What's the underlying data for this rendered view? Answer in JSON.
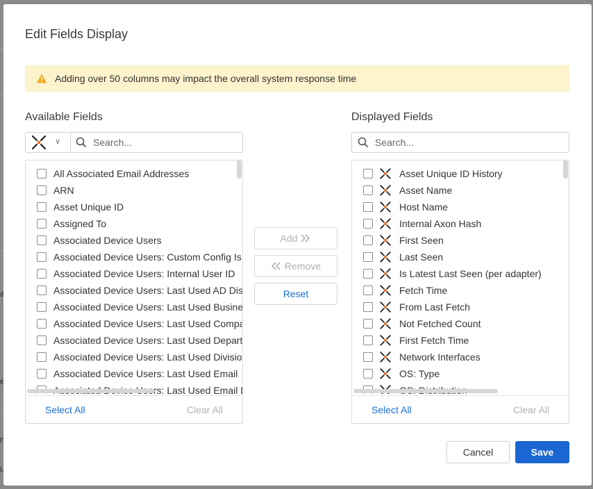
{
  "background": {
    "edge_chars": [
      "a",
      "e",
      "n",
      "u"
    ]
  },
  "dialog": {
    "title": "Edit Fields Display",
    "warning": {
      "icon": "warning-triangle-icon",
      "text": "Adding over 50 columns may impact the overall system response time",
      "color": "#fdf3cd",
      "icon_color": "#f0a81c"
    },
    "available": {
      "label": "Available Fields",
      "adapter_icon": "axonius-logo-icon",
      "search_placeholder": "Search...",
      "items": [
        "All Associated Email Addresses",
        "ARN",
        "Asset Unique ID",
        "Assigned To",
        "Associated Device Users",
        "Associated Device Users: Custom Config Is Private",
        "Associated Device Users: Internal User ID",
        "Associated Device Users: Last Used AD Display Name",
        "Associated Device Users: Last Used Business Unit",
        "Associated Device Users: Last Used Company",
        "Associated Device Users: Last Used Department",
        "Associated Device Users: Last Used Division",
        "Associated Device Users: Last Used Email",
        "Associated Device Users: Last Used Email Domain"
      ],
      "select_all": "Select All",
      "clear_all": "Clear All"
    },
    "actions": {
      "add": "Add",
      "add_icon": "double-chevron-right-icon",
      "remove": "Remove",
      "remove_icon": "double-chevron-left-icon",
      "reset": "Reset"
    },
    "displayed": {
      "label": "Displayed Fields",
      "search_placeholder": "Search...",
      "items": [
        "Asset Unique ID History",
        "Asset Name",
        "Host Name",
        "Internal Axon Hash",
        "First Seen",
        "Last Seen",
        "Is Latest Last Seen (per adapter)",
        "Fetch Time",
        "From Last Fetch",
        "Not Fetched Count",
        "First Fetch Time",
        "Network Interfaces",
        "OS: Type",
        "OS: Distribution"
      ],
      "select_all": "Select All",
      "clear_all": "Clear All"
    },
    "buttons": {
      "cancel": "Cancel",
      "save": "Save"
    },
    "colors": {
      "accent": "#1a66d2",
      "link": "#1a6fd6",
      "logo_dark": "#1e1e1e",
      "logo_orange": "#f36f21"
    }
  }
}
